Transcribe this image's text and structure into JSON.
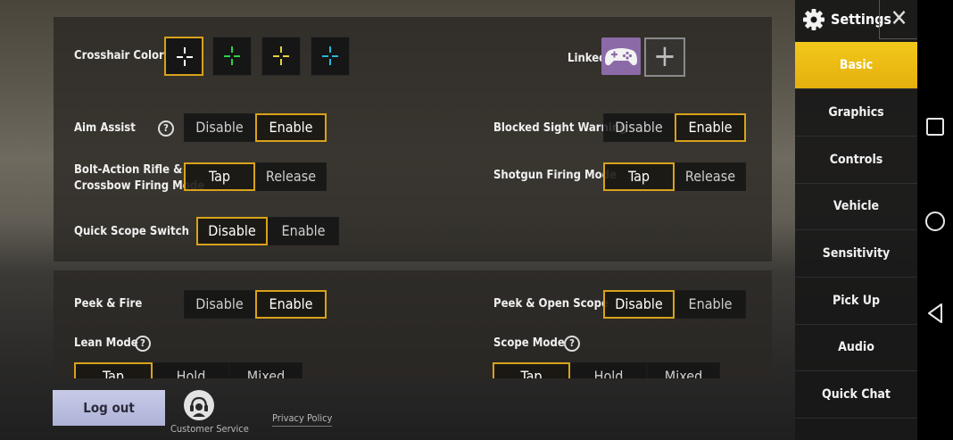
{
  "crosshair": {
    "label": "Crosshair Color",
    "options": [
      {
        "name": "white",
        "color": "#ffffff",
        "selected": true
      },
      {
        "name": "green",
        "color": "#2fd24a",
        "selected": false
      },
      {
        "name": "yellow",
        "color": "#e9d23a",
        "selected": false
      },
      {
        "name": "cyan",
        "color": "#2bb7d6",
        "selected": false
      }
    ]
  },
  "linked": {
    "label": "Linked",
    "gamepad_icon": "gamepad-icon",
    "add_symbol": "+"
  },
  "settings_left": [
    {
      "label": "Aim Assist",
      "help": true,
      "options": [
        "Disable",
        "Enable"
      ],
      "selected": 1
    },
    {
      "label": "Bolt-Action Rifle & Crossbow Firing Mode",
      "line1": "Bolt-Action Rifle &",
      "line2": "Crossbow Firing Mode",
      "options": [
        "Tap",
        "Release"
      ],
      "selected": 0
    },
    {
      "label": "Quick Scope Switch",
      "options": [
        "Disable",
        "Enable"
      ],
      "selected": 0
    }
  ],
  "settings_right": [
    {
      "label": "Blocked Sight Warning",
      "options": [
        "Disable",
        "Enable"
      ],
      "selected": 1
    },
    {
      "label": "Shotgun Firing Mode",
      "options": [
        "Tap",
        "Release"
      ],
      "selected": 0
    }
  ],
  "panel2_left": [
    {
      "label": "Peek & Fire",
      "options": [
        "Disable",
        "Enable"
      ],
      "selected": 1
    },
    {
      "label": "Lean Mode",
      "help": true,
      "options": [
        "Tap",
        "Hold",
        "Mixed"
      ],
      "selected": 0
    }
  ],
  "panel2_right": [
    {
      "label": "Peek & Open Scope",
      "options": [
        "Disable",
        "Enable"
      ],
      "selected": 0
    },
    {
      "label": "Scope Mode",
      "help": true,
      "options": [
        "Tap",
        "Hold",
        "Mixed"
      ],
      "selected": 0
    }
  ],
  "help_symbol": "?",
  "bottom": {
    "logout": "Log out",
    "customer_service": "Customer Service",
    "privacy": "Privacy Policy"
  },
  "sidebar": {
    "title": "Settings",
    "close": "✕",
    "items": [
      "Basic",
      "Graphics",
      "Controls",
      "Vehicle",
      "Sensitivity",
      "Pick Up",
      "Audio",
      "Quick Chat"
    ],
    "active": 0
  },
  "android_nav": [
    "square-icon",
    "circle-icon",
    "back-triangle-icon"
  ],
  "accent_color": "#d8a21a"
}
